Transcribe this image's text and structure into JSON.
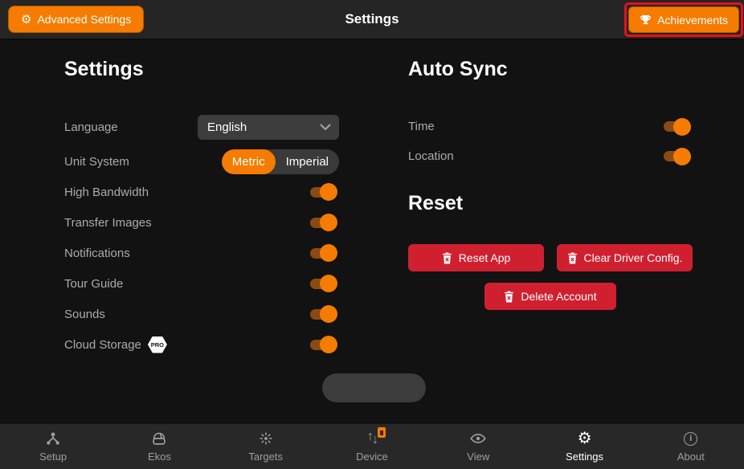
{
  "header": {
    "title": "Settings",
    "advanced_button": {
      "label": "Advanced Settings",
      "icon": "gear-icon"
    },
    "achievements_button": {
      "label": "Achievements",
      "icon": "trophy-icon",
      "highlighted": true
    }
  },
  "settings_section": {
    "title": "Settings",
    "language": {
      "label": "Language",
      "value": "English",
      "icon": "chevron-down-icon"
    },
    "unit_system": {
      "label": "Unit System",
      "options": [
        "Metric",
        "Imperial"
      ],
      "selected": "Metric"
    },
    "toggles": [
      {
        "label": "High Bandwidth",
        "on": true
      },
      {
        "label": "Transfer Images",
        "on": true
      },
      {
        "label": "Notifications",
        "on": true
      },
      {
        "label": "Tour Guide",
        "on": true
      },
      {
        "label": "Sounds",
        "on": true
      },
      {
        "label": "Cloud Storage",
        "on": true,
        "badge": "PRO"
      }
    ]
  },
  "auto_sync_section": {
    "title": "Auto Sync",
    "toggles": [
      {
        "label": "Time",
        "on": true
      },
      {
        "label": "Location",
        "on": true
      }
    ]
  },
  "reset_section": {
    "title": "Reset",
    "buttons": [
      {
        "label": "Reset App",
        "icon": "delete-icon"
      },
      {
        "label": "Clear Driver Config.",
        "icon": "delete-icon"
      },
      {
        "label": "Delete Account",
        "icon": "delete-icon"
      }
    ]
  },
  "bottom_nav": {
    "active": "Settings",
    "items": [
      {
        "label": "Setup",
        "icon": "network-nodes-icon"
      },
      {
        "label": "Ekos",
        "icon": "observatory-dome-icon"
      },
      {
        "label": "Targets",
        "icon": "star-target-icon"
      },
      {
        "label": "Device",
        "icon": "transfer-arrows-icon",
        "badge": true
      },
      {
        "label": "View",
        "icon": "eye-icon"
      },
      {
        "label": "Settings",
        "icon": "gear-icon"
      },
      {
        "label": "About",
        "icon": "info-icon"
      }
    ]
  },
  "colors": {
    "accent_orange": "#F57C00",
    "danger_red": "#D0202F",
    "highlight_border_red": "#E8101C",
    "header_bg": "#252525",
    "content_bg": "#121212"
  }
}
